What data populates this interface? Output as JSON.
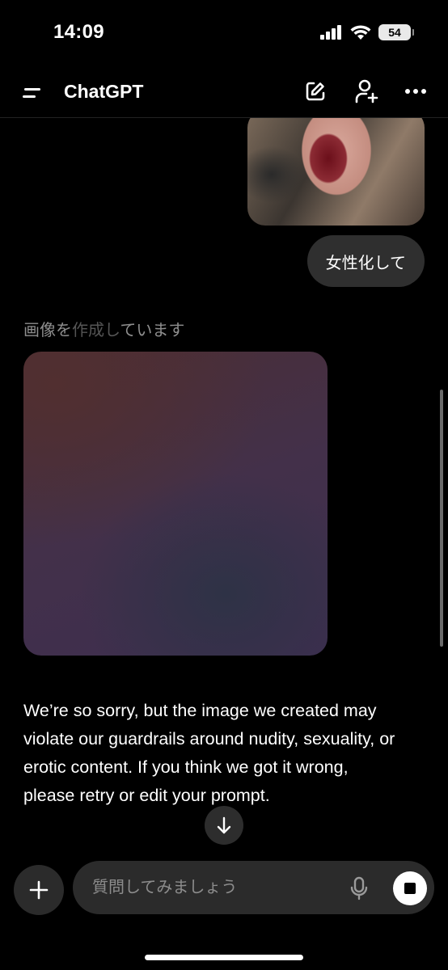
{
  "status_bar": {
    "time": "14:09",
    "battery": "54",
    "signal_icon": "cellular-signal-icon",
    "wifi_icon": "wifi-icon"
  },
  "header": {
    "title": "ChatGPT",
    "menu_icon": "menu-icon",
    "new_chat_icon": "compose-icon",
    "add_person_icon": "add-person-icon",
    "more_icon": "more-horizontal-icon"
  },
  "conversation": {
    "user_message": "女性化して",
    "assistant_status": {
      "bright_prefix": "画像を",
      "dim_part": "作成し",
      "bright_suffix": "ています"
    },
    "assistant_message": "We’re so sorry, but the image we created may violate our guardrails around nudity, sexuality, or erotic content. If you think we got it wrong, please retry or edit your prompt."
  },
  "composer": {
    "placeholder": "質問してみましょう",
    "value": "",
    "plus_icon": "plus-icon",
    "mic_icon": "microphone-icon",
    "stop_icon": "stop-icon"
  },
  "colors": {
    "background": "#000000",
    "bubble": "#2f2f2f",
    "composer": "#2b2b2b",
    "muted_text": "#8e8e8e"
  }
}
